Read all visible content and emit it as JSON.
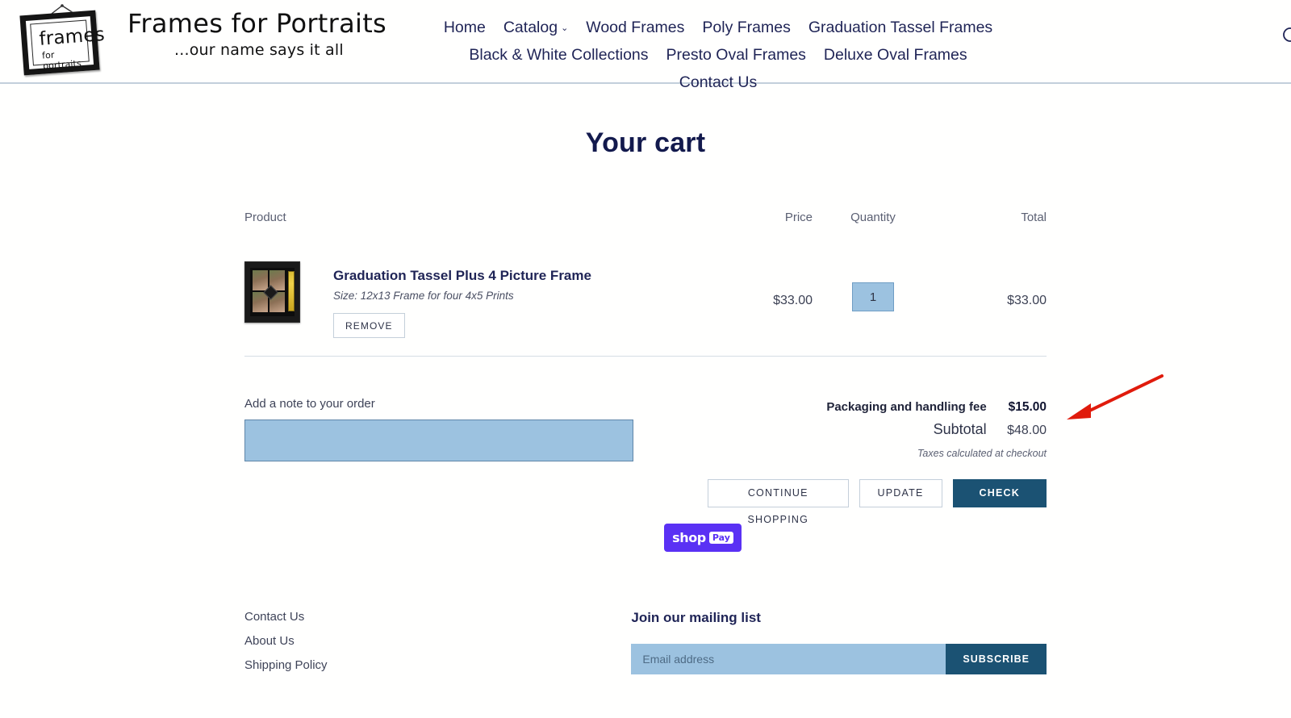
{
  "header": {
    "logo": {
      "frame_word_top": "frames",
      "frame_word_bottom": "for portraits",
      "icon": "picture-frame-logo"
    },
    "brand_title": "Frames for Portraits",
    "brand_tagline": "...our name says it all",
    "search_icon": "search-icon",
    "nav_row1": [
      {
        "label": "Home",
        "has_caret": false
      },
      {
        "label": "Catalog",
        "has_caret": true
      },
      {
        "label": "Wood Frames",
        "has_caret": false
      },
      {
        "label": "Poly Frames",
        "has_caret": false
      },
      {
        "label": "Graduation Tassel Frames",
        "has_caret": false
      }
    ],
    "nav_row2": [
      {
        "label": "Black & White Collections",
        "has_caret": false
      },
      {
        "label": "Presto Oval Frames",
        "has_caret": false
      },
      {
        "label": "Deluxe Oval Frames",
        "has_caret": false
      },
      {
        "label": "Contact Us",
        "has_caret": false
      }
    ]
  },
  "page_title": "Your cart",
  "cart": {
    "columns": {
      "product": "Product",
      "price": "Price",
      "quantity": "Quantity",
      "total": "Total"
    },
    "items": [
      {
        "thumb_icon": "graduation-tassel-frame-thumbnail",
        "title": "Graduation Tassel Plus 4 Picture Frame",
        "variant": "Size: 12x13 Frame for four 4x5 Prints",
        "remove_label": "REMOVE",
        "price": "$33.00",
        "quantity": "1",
        "total": "$33.00"
      }
    ],
    "note": {
      "label": "Add a note to your order",
      "value": "",
      "placeholder": ""
    },
    "totals": {
      "fee_label": "Packaging and handling fee",
      "fee_value": "$15.00",
      "subtotal_label": "Subtotal",
      "subtotal_value": "$48.00",
      "tax_note": "Taxes calculated at checkout"
    },
    "actions": {
      "continue_label": "CONTINUE SHOPPING",
      "update_label": "UPDATE",
      "checkout_label": "CHECK OUT"
    },
    "shop_pay": {
      "shop_text": "shop",
      "pay_text": "Pay"
    }
  },
  "footer": {
    "links": [
      {
        "label": "Contact Us"
      },
      {
        "label": "About Us"
      },
      {
        "label": "Shipping Policy"
      }
    ],
    "newsletter": {
      "title": "Join our mailing list",
      "placeholder": "Email address",
      "value": "",
      "button_label": "SUBSCRIBE"
    }
  },
  "annotation": {
    "type": "red-arrow",
    "color": "#e01b0c",
    "points_to": "$15.00"
  },
  "colors": {
    "brand_navy": "#1f2456",
    "title_navy": "#131a4d",
    "primary_button": "#1b5273",
    "highlight_blue": "#9cc2e0",
    "shop_pay_purple": "#5a31f4",
    "annotation_red": "#e01b0c"
  }
}
